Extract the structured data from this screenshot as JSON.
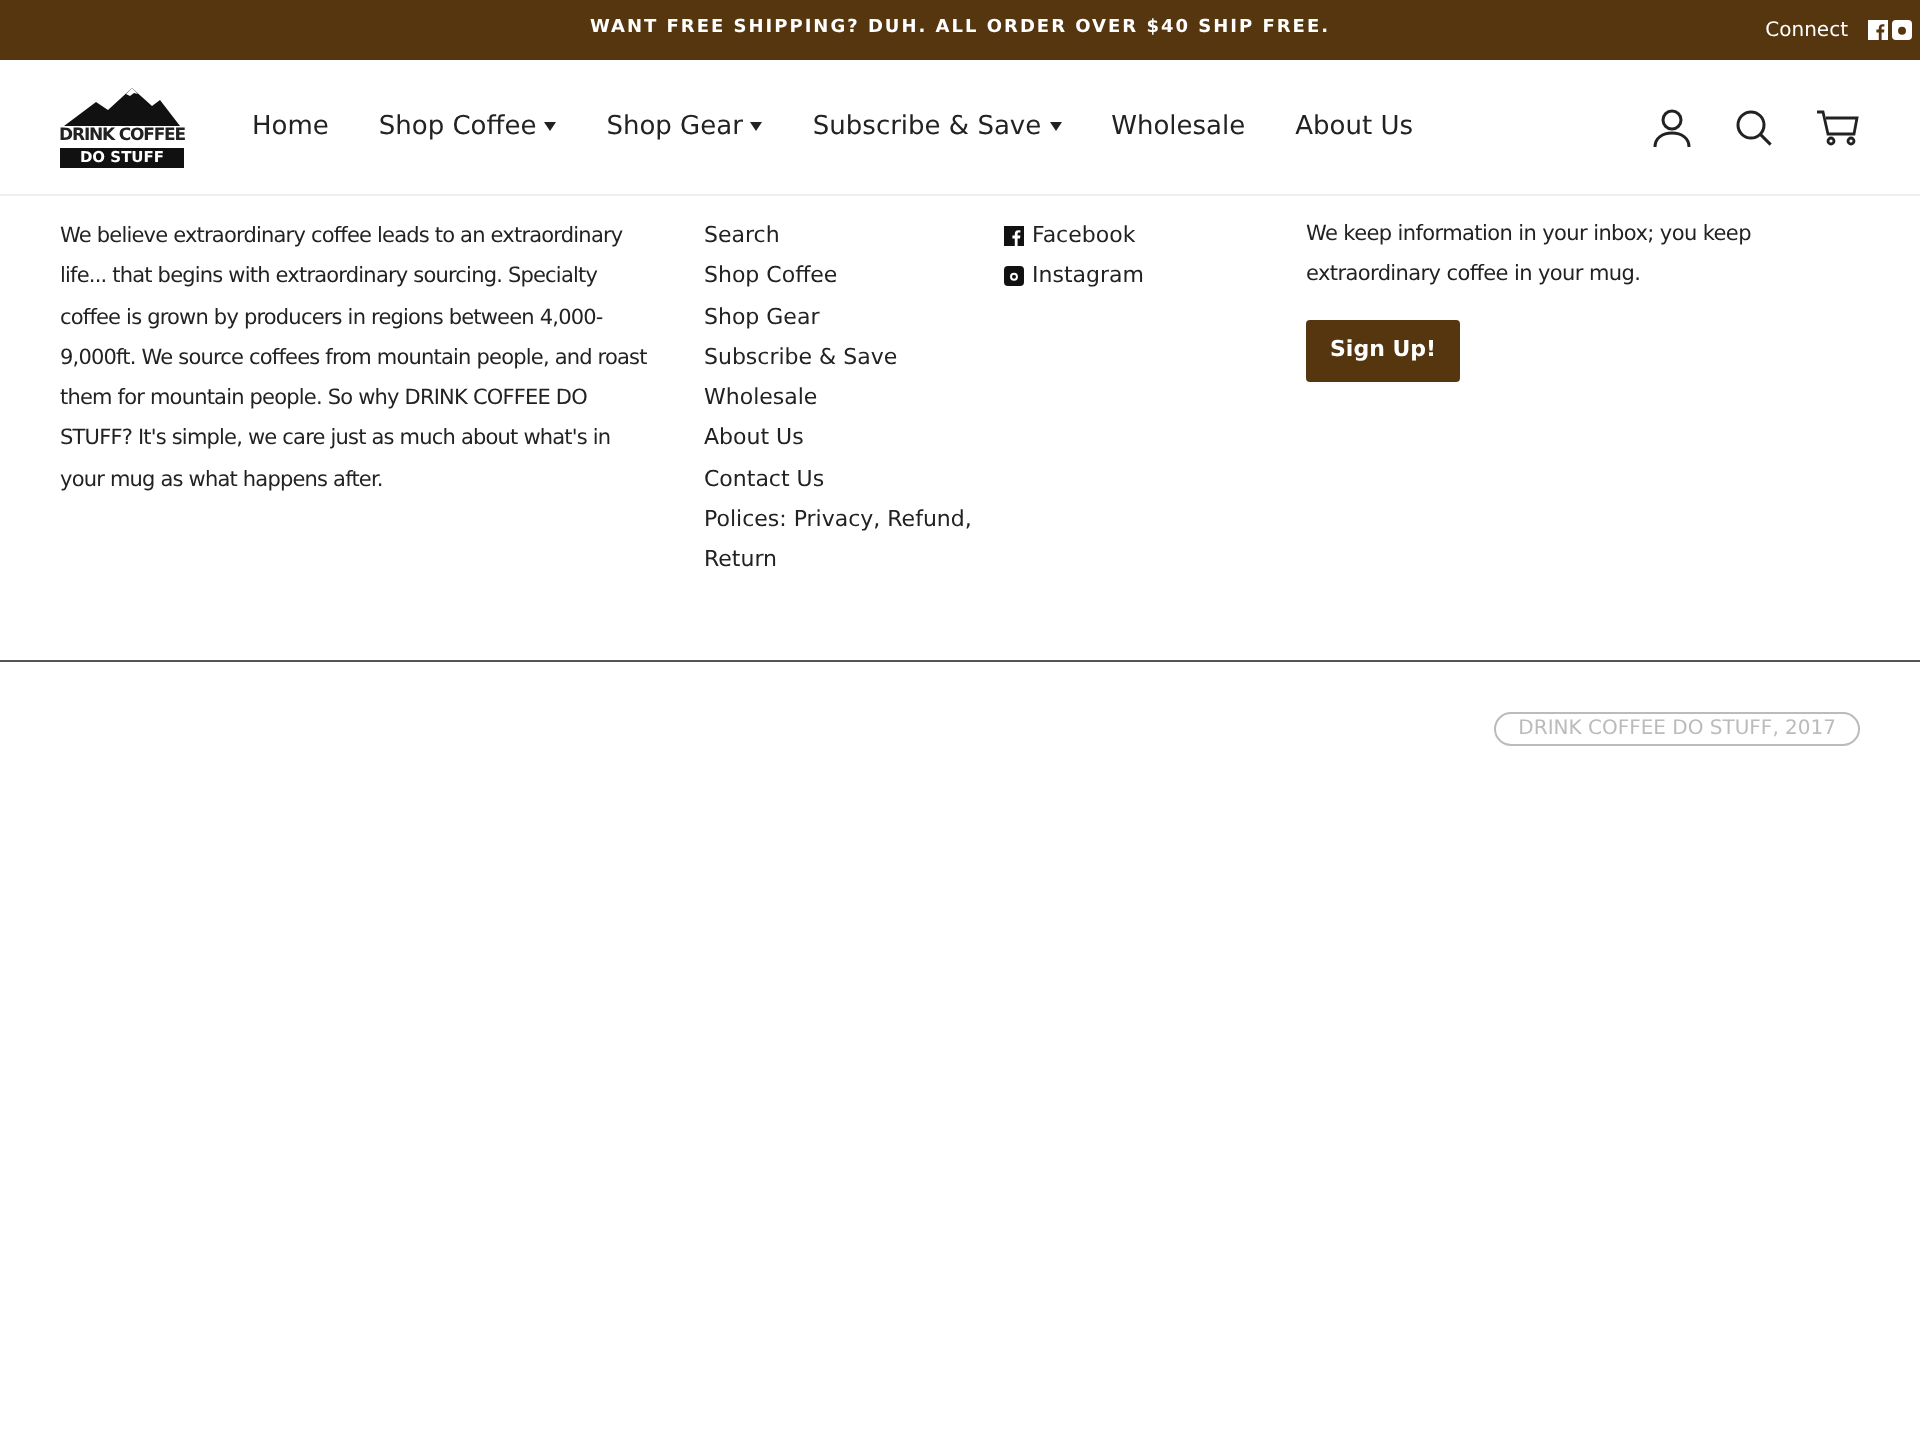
{
  "announcement": "WANT FREE SHIPPING? DUH. ALL ORDER OVER $40 SHIP FREE.",
  "connect": {
    "label": "Connect"
  },
  "logo": {
    "line_1": "DRINK COFFEE",
    "line_2": "DO STUFF"
  },
  "nav": [
    {
      "label": "Home",
      "dropdown": false
    },
    {
      "label": "Shop Coffee",
      "dropdown": true
    },
    {
      "label": "Shop Gear",
      "dropdown": true
    },
    {
      "label": "Subscribe & Save",
      "dropdown": true
    },
    {
      "label": "Wholesale",
      "dropdown": false
    },
    {
      "label": "About Us",
      "dropdown": false
    }
  ],
  "about": "We believe extraordinary coffee leads to an extraordinary life... that begins with extraordinary sourcing. Specialty coffee is grown by producers in regions between 4,000-9,000ft. We source coffees from mountain people, and roast them for mountain people. So why DRINK COFFEE DO STUFF? It's simple, we care just as much about what's in your mug as what happens after.",
  "footer_links": [
    "Search",
    "Shop Coffee",
    "Shop Gear",
    "Subscribe & Save",
    "Wholesale",
    "About Us",
    "Contact Us",
    "Polices: Privacy, Refund, Return"
  ],
  "social_links": [
    {
      "kind": "facebook",
      "label": "Facebook"
    },
    {
      "kind": "instagram",
      "label": "Instagram"
    }
  ],
  "newsletter": {
    "text": "We keep information in your inbox; you keep extraordinary coffee in your mug.",
    "button": "Sign Up!"
  },
  "copyright": "DRINK COFFEE DO STUFF, 2017"
}
